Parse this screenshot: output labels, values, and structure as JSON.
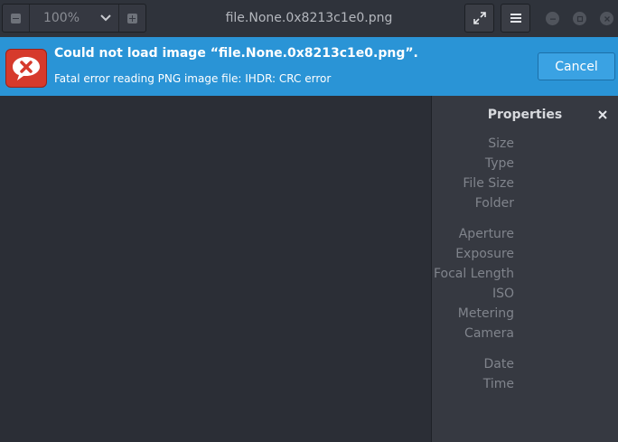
{
  "header": {
    "zoom_value": "100%",
    "title": "file.None.0x8213c1e0.png"
  },
  "infobar": {
    "message": "Could not load image “file.None.0x8213c1e0.png”.",
    "detail": "Fatal error reading PNG image file: IHDR: CRC error",
    "cancel_label": "Cancel"
  },
  "properties": {
    "title": "Properties",
    "labels": [
      "Size",
      "Type",
      "File Size",
      "Folder",
      "Aperture",
      "Exposure",
      "Focal Length",
      "ISO",
      "Metering",
      "Camera",
      "Date",
      "Time"
    ]
  },
  "colors": {
    "accent": "#2a94d6",
    "error_icon": "#d63a2c",
    "background": "#2b2e36"
  }
}
